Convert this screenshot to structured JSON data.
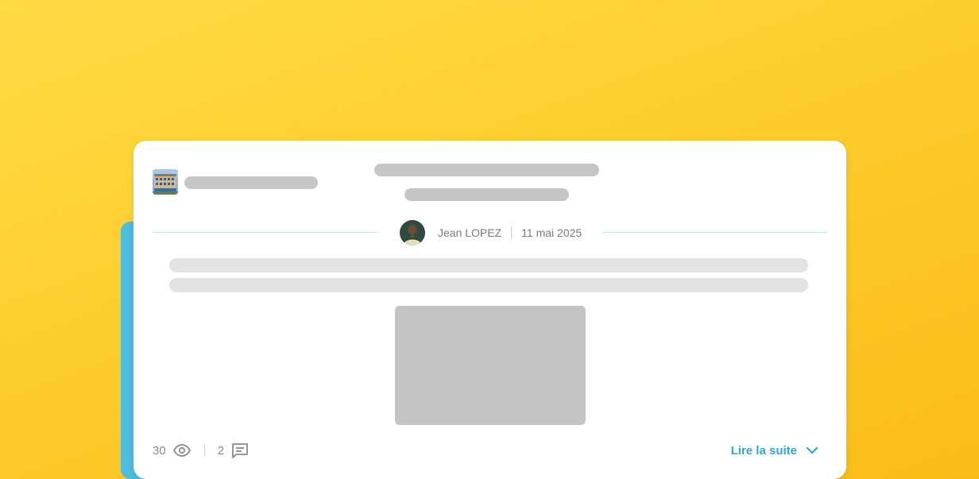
{
  "post": {
    "author_name": "Jean LOPEZ",
    "date": "11 mai 2025",
    "views_count": "30",
    "comments_count": "2",
    "read_more_label": "Lire la suite"
  },
  "icons": {
    "views": "eye-icon",
    "comments": "comment-icon",
    "read_more": "chevron-down-icon"
  },
  "colors": {
    "background_top": "#ffdb45",
    "background_bottom": "#f9bc17",
    "accent_strip": "#4cbcdf",
    "link": "#2fa8d3",
    "skeleton_dark": "#c6c6c6",
    "skeleton_light": "#e3e3e3"
  }
}
